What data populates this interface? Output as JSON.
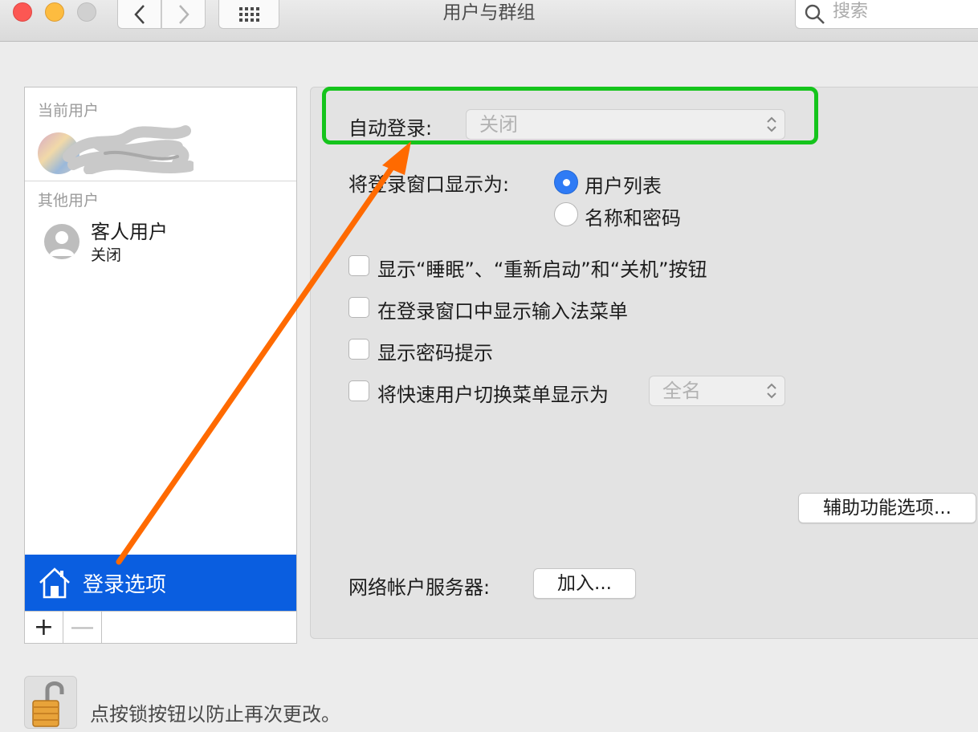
{
  "window": {
    "title": "用户与群组",
    "search_placeholder": "搜索"
  },
  "sidebar": {
    "current_users_label": "当前用户",
    "other_users_label": "其他用户",
    "guest": {
      "name": "客人用户",
      "status": "关闭"
    },
    "login_options_label": "登录选项",
    "add_symbol": "+",
    "remove_symbol": "—"
  },
  "main": {
    "auto_login": {
      "label": "自动登录:",
      "value": "关闭"
    },
    "display_login_as": {
      "label": "将登录窗口显示为:",
      "options": [
        "用户列表",
        "名称和密码"
      ],
      "selected": "用户列表"
    },
    "checkboxes": [
      {
        "label": "显示“睡眠”、“重新启动”和“关机”按钮",
        "checked": false
      },
      {
        "label": "在登录窗口中显示输入法菜单",
        "checked": false
      },
      {
        "label": "显示密码提示",
        "checked": false
      },
      {
        "label": "将快速用户切换菜单显示为",
        "checked": false
      }
    ],
    "fast_switch_value": "全名",
    "accessibility_button": "辅助功能选项...",
    "network_server": {
      "label": "网络帐户服务器:",
      "button": "加入..."
    }
  },
  "footer": {
    "lock_text": "点按锁按钮以防止再次更改。"
  },
  "colors": {
    "selection_blue": "#0a5ee0",
    "highlight_green": "#15c41c",
    "annotation_orange": "#ff6a00",
    "radio_blue": "#2f7bf5"
  }
}
